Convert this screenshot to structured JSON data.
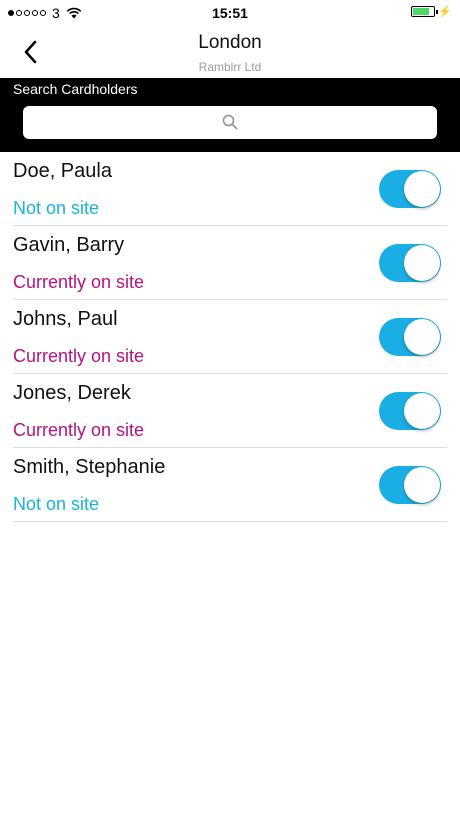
{
  "status_bar": {
    "carrier": "3",
    "time": "15:51",
    "signal_filled": 1,
    "signal_total": 5,
    "battery_level": 0.7
  },
  "nav": {
    "title": "London",
    "subtitle": "Ramblrr Ltd",
    "back_icon": "chevron-left-icon"
  },
  "search": {
    "label": "Search Cardholders",
    "placeholder": "",
    "value": "",
    "icon": "search-icon"
  },
  "colors": {
    "toggle_on": "#1aaee5",
    "status_not_on_site": "#19b4dc",
    "status_on_site": "#b3137f",
    "search_bar_bg": "#000000",
    "battery": "#4cd964"
  },
  "cardholders": [
    {
      "name": "Doe, Paula",
      "status": "Not on site",
      "on_site": false,
      "toggle_on": true
    },
    {
      "name": "Gavin, Barry",
      "status": "Currently on site",
      "on_site": true,
      "toggle_on": true
    },
    {
      "name": "Johns, Paul",
      "status": "Currently on site",
      "on_site": true,
      "toggle_on": true
    },
    {
      "name": "Jones, Derek",
      "status": "Currently on site",
      "on_site": true,
      "toggle_on": true
    },
    {
      "name": "Smith, Stephanie",
      "status": "Not on site",
      "on_site": false,
      "toggle_on": true
    }
  ]
}
